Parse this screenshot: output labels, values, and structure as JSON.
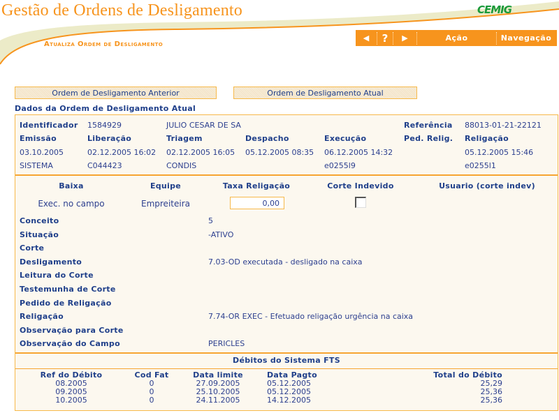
{
  "header": {
    "title": "Gestão de Ordens de Desligamento",
    "subtitle": "Atualiza Ordem de Desligamento",
    "logo": "CEMIG",
    "nav": {
      "back_icon": "◀",
      "help_icon": "?",
      "forward_icon": "▶",
      "acao_label": "Ação",
      "navegacao_label": "Navegação"
    }
  },
  "tabs": {
    "previous_label": "Ordem de Desligamento Anterior",
    "current_label": "Ordem de Desligamento Atual"
  },
  "section_title": "Dados da Ordem de Desligamento Atual",
  "order": {
    "identificador_label": "Identificador",
    "identificador": "1584929",
    "nome": "JULIO CESAR DE SA",
    "referencia_label": "Referência",
    "referencia": "88013-01-21-22121",
    "headers": [
      "Emissão",
      "Liberação",
      "Triagem",
      "Despacho",
      "Execução",
      "Ped. Relig.",
      "Religação"
    ],
    "dates": [
      "03.10.2005",
      "02.12.2005 16:02",
      "02.12.2005 16:05",
      "05.12.2005 08:35",
      "06.12.2005 14:32",
      "",
      "05.12.2005 15:46"
    ],
    "users": [
      "SISTEMA",
      "C044423",
      "CONDIS",
      "",
      "e0255l9",
      "",
      "e0255l1"
    ]
  },
  "baixa": {
    "headers": [
      "Baixa",
      "Equipe",
      "Taxa Religação",
      "Corte Indevido",
      "Usuario (corte indev)"
    ],
    "baixa_value": "Exec. no campo",
    "equipe_value": "Empreiteira",
    "taxa_value": "0,00",
    "corte_indevido_checked": false,
    "usuario_value": ""
  },
  "details": [
    {
      "label": "Conceito",
      "value": "5"
    },
    {
      "label": "Situação",
      "value": "-ATIVO"
    },
    {
      "label": "Corte",
      "value": ""
    },
    {
      "label": "Desligamento",
      "value": "7.03-OD executada - desligado na caixa"
    },
    {
      "label": "Leitura do Corte",
      "value": ""
    },
    {
      "label": "Testemunha de Corte",
      "value": ""
    },
    {
      "label": "Pedido de Religação",
      "value": ""
    },
    {
      "label": "Religação",
      "value": "7.74-OR EXEC - Efetuado religação urgência na caixa"
    },
    {
      "label": "Observação para Corte",
      "value": ""
    },
    {
      "label": "Observação do Campo",
      "value": "PERICLES"
    }
  ],
  "debitos": {
    "title": "Débitos do Sistema FTS",
    "columns": [
      "Ref do Débito",
      "Cod Fat",
      "Data limite",
      "Data Pagto",
      "Total do Débito"
    ],
    "rows": [
      [
        "08.2005",
        "0",
        "27.09.2005",
        "05.12.2005",
        "25,29"
      ],
      [
        "09.2005",
        "0",
        "25.10.2005",
        "05.12.2005",
        "25,36"
      ],
      [
        "10.2005",
        "0",
        "24.11.2005",
        "14.12.2005",
        "25,36"
      ]
    ]
  },
  "colors": {
    "brand_orange": "#f7941d",
    "text_blue": "#1f3f8a",
    "logo_green": "#1a9a3a",
    "panel_bg": "#fcf8ef"
  }
}
